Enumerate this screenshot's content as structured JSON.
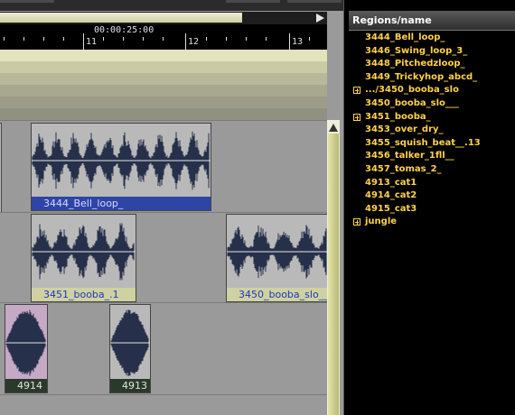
{
  "ruler": {
    "timecode": "00:00:25:00",
    "bar_numbers": [
      "11",
      "12",
      "13"
    ]
  },
  "tracks": [
    {
      "regions": [
        {
          "name": "3444_Bell_loop_",
          "color": "#2d45a5"
        }
      ]
    },
    {
      "regions": [
        {
          "name": "3451_booba_.1",
          "color": "#cfd2a0"
        },
        {
          "name": "3450_booba_slo___",
          "color": "#cfd2a0"
        }
      ]
    },
    {
      "regions": [
        {
          "name": "4914",
          "color": "#2a3a2a"
        },
        {
          "name": "4913",
          "color": "#2a3a2a"
        }
      ]
    }
  ],
  "regions_panel": {
    "header": "Regions/name",
    "items": [
      {
        "label": "3444_Bell_loop_",
        "expandable": false
      },
      {
        "label": "3446_Swing_loop_3_",
        "expandable": false
      },
      {
        "label": "3448_Pitchedzloop_",
        "expandable": false
      },
      {
        "label": "3449_Trickyhop_abcd_",
        "expandable": false
      },
      {
        "label": ".../3450_booba_slo",
        "expandable": true
      },
      {
        "label": "3450_booba_slo___",
        "expandable": false
      },
      {
        "label": "3451_booba_",
        "expandable": true
      },
      {
        "label": "3453_over_dry_",
        "expandable": false
      },
      {
        "label": "3455_squish_beat__.13",
        "expandable": false
      },
      {
        "label": "3456_talker_1fll__",
        "expandable": false
      },
      {
        "label": "3457_tomas_2_",
        "expandable": false
      },
      {
        "label": "4913_cat1",
        "expandable": false
      },
      {
        "label": "4914_cat2",
        "expandable": false
      },
      {
        "label": "4915_cat3",
        "expandable": false
      },
      {
        "label": "jungle",
        "expandable": true
      }
    ]
  },
  "colors": {
    "list_text": "#ffd24a",
    "track_bg": "#9a9a9a",
    "region_bg": "#b9b9b9",
    "waveform": "#27304a"
  }
}
